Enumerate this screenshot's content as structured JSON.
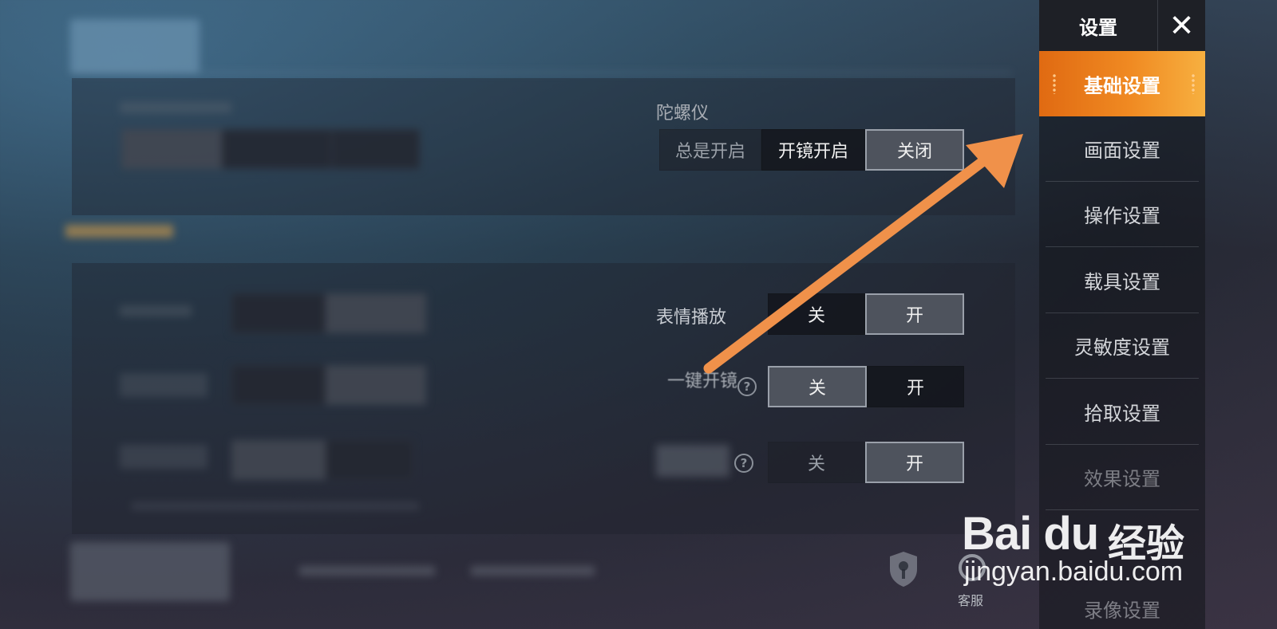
{
  "menu": {
    "title": "设置",
    "close_label": "✕",
    "items": [
      {
        "label": "基础设置"
      },
      {
        "label": "画面设置"
      },
      {
        "label": "操作设置"
      },
      {
        "label": "载具设置"
      },
      {
        "label": "灵敏度设置"
      },
      {
        "label": "拾取设置"
      },
      {
        "label": "效果设置"
      },
      {
        "label": "录像设置"
      }
    ]
  },
  "gyroscope": {
    "label": "陀螺仪",
    "options": [
      "总是开启",
      "开镜开启",
      "关闭"
    ],
    "selected": "关闭"
  },
  "emote_play": {
    "label": "表情播放",
    "options": [
      "关",
      "开"
    ],
    "selected": "开"
  },
  "one_key_scope": {
    "label": "一键开镜",
    "options": [
      "关",
      "开"
    ],
    "selected": "关"
  },
  "row_three": {
    "options": [
      "关",
      "开"
    ],
    "selected": "开"
  },
  "bottom": {
    "icon_label": "客服"
  },
  "watermark": {
    "logo": "Bai du",
    "cn": "经验",
    "url": "jingyan.baidu.com"
  },
  "colors": {
    "accent": "#f08a22",
    "arrow": "#f0914a",
    "section_title": "#e0a347"
  }
}
